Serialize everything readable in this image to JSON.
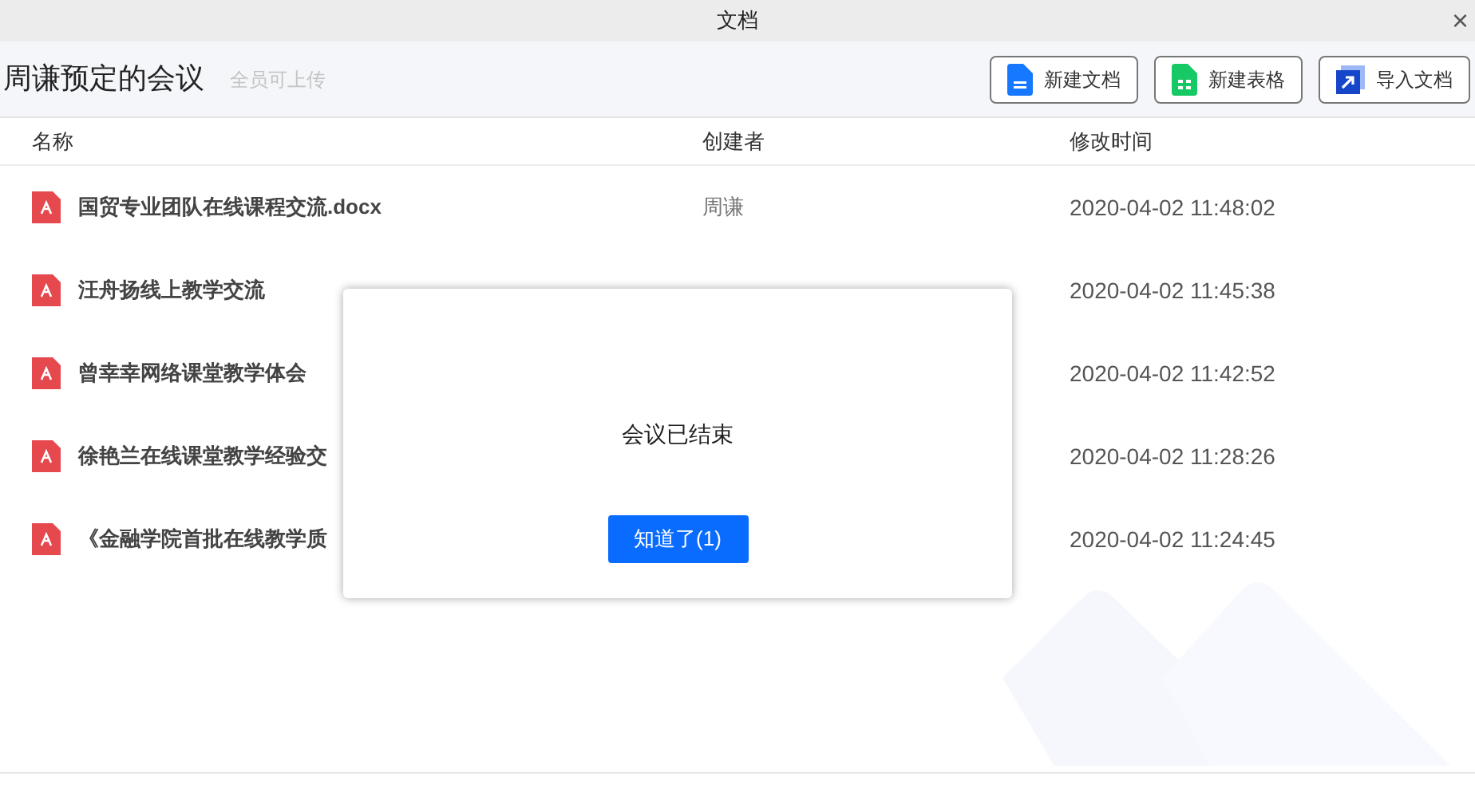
{
  "window": {
    "title": "文档",
    "close": "×"
  },
  "header": {
    "title": "周谦预定的会议",
    "hint": "全员可上传",
    "buttons": [
      {
        "label": "新建文档",
        "kind": "doc"
      },
      {
        "label": "新建表格",
        "kind": "sheet"
      },
      {
        "label": "导入文档",
        "kind": "import"
      }
    ]
  },
  "table": {
    "columns": [
      "名称",
      "创建者",
      "修改时间"
    ],
    "rows": [
      {
        "name": "国贸专业团队在线课程交流.docx",
        "creator": "周谦",
        "modified": "2020-04-02 11:48:02"
      },
      {
        "name": "汪舟扬线上教学交流",
        "modified": "2020-04-02 11:45:38"
      },
      {
        "name": "曾幸幸网络课堂教学体会",
        "modified": "2020-04-02 11:42:52"
      },
      {
        "name": "徐艳兰在线课堂教学经验交",
        "modified": "2020-04-02 11:28:26"
      },
      {
        "name": "《金融学院首批在线教学质",
        "modified": "2020-04-02 11:24:45"
      }
    ]
  },
  "dialog": {
    "message": "会议已结束",
    "button": "知道了(1)"
  }
}
